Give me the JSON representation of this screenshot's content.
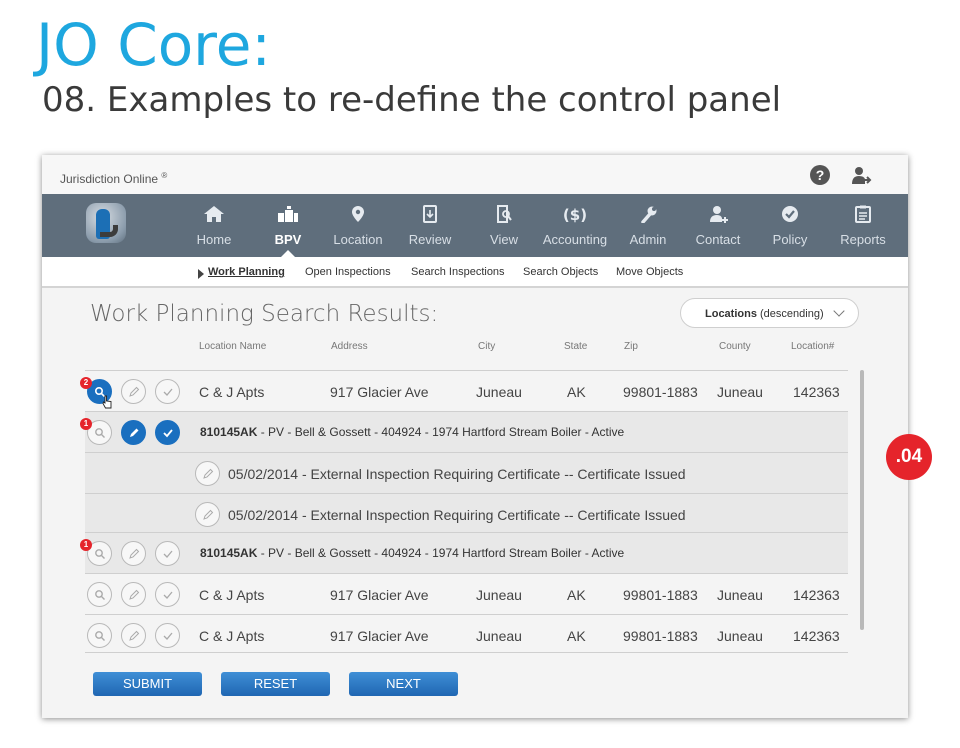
{
  "slide": {
    "title": "JO Core:",
    "subtitle": "08. Examples to re-define the control panel",
    "marker": ".04"
  },
  "app": {
    "name": "Jurisdiction Online",
    "registered": "®",
    "help": "?",
    "icons": {
      "help": "help-circle-icon",
      "user": "user-logout-icon",
      "logo": "jurisdiction-online-logo"
    }
  },
  "nav": {
    "items": [
      {
        "label": "Home",
        "icon": "home-icon"
      },
      {
        "label": "BPV",
        "icon": "boiler-icon",
        "active": true
      },
      {
        "label": "Location",
        "icon": "map-pin-icon"
      },
      {
        "label": "Review",
        "icon": "review-doc-icon"
      },
      {
        "label": "View",
        "icon": "view-doc-icon"
      },
      {
        "label": "Accounting",
        "icon": "dollar-icon"
      },
      {
        "label": "Admin",
        "icon": "wrench-icon"
      },
      {
        "label": "Contact",
        "icon": "contact-add-icon"
      },
      {
        "label": "Policy",
        "icon": "check-badge-icon"
      },
      {
        "label": "Reports",
        "icon": "clipboard-icon"
      }
    ]
  },
  "subnav": {
    "items": [
      {
        "label": "Work Planning",
        "active": true
      },
      {
        "label": "Open Inspections"
      },
      {
        "label": "Search Inspections"
      },
      {
        "label": "Search Objects"
      },
      {
        "label": "Move Objects"
      }
    ]
  },
  "results": {
    "title": "Work Planning Search Results:",
    "sort": {
      "bold": "Locations",
      "rest": "(descending)"
    },
    "columns": [
      "Location Name",
      "Address",
      "City",
      "State",
      "Zip",
      "County",
      "Location#"
    ],
    "rows": [
      {
        "name": "C & J Apts",
        "address": "917 Glacier Ave",
        "city": "Juneau",
        "state": "AK",
        "zip": "99801-1883",
        "county": "Juneau",
        "location": "142363",
        "badge": "2"
      },
      {
        "object_bold": "810145AK",
        "object_text": " - PV - Bell & Gossett - 404924 - 1974 Hartford Stream Boiler - Active",
        "badge": "1"
      },
      {
        "inspection": "05/02/2014 - External Inspection Requiring Certificate -- Certificate Issued"
      },
      {
        "inspection": "05/02/2014 - External Inspection Requiring Certificate -- Certificate Issued"
      },
      {
        "object_bold": "810145AK",
        "object_text": " - PV - Bell & Gossett - 404924 - 1974 Hartford Stream Boiler - Active",
        "badge": "1"
      },
      {
        "name": "C & J Apts",
        "address": "917 Glacier Ave",
        "city": "Juneau",
        "state": "AK",
        "zip": "99801-1883",
        "county": "Juneau",
        "location": "142363"
      },
      {
        "name": "C & J Apts",
        "address": "917 Glacier Ave",
        "city": "Juneau",
        "state": "AK",
        "zip": "99801-1883",
        "county": "Juneau",
        "location": "142363"
      }
    ]
  },
  "buttons": {
    "submit": "SUBMIT",
    "reset": "RESET",
    "next": "NEXT"
  },
  "colors": {
    "accent": "#1ea7df",
    "nav": "#5f6e7c",
    "primary": "#1a6fbf",
    "alert": "#e5242b"
  }
}
